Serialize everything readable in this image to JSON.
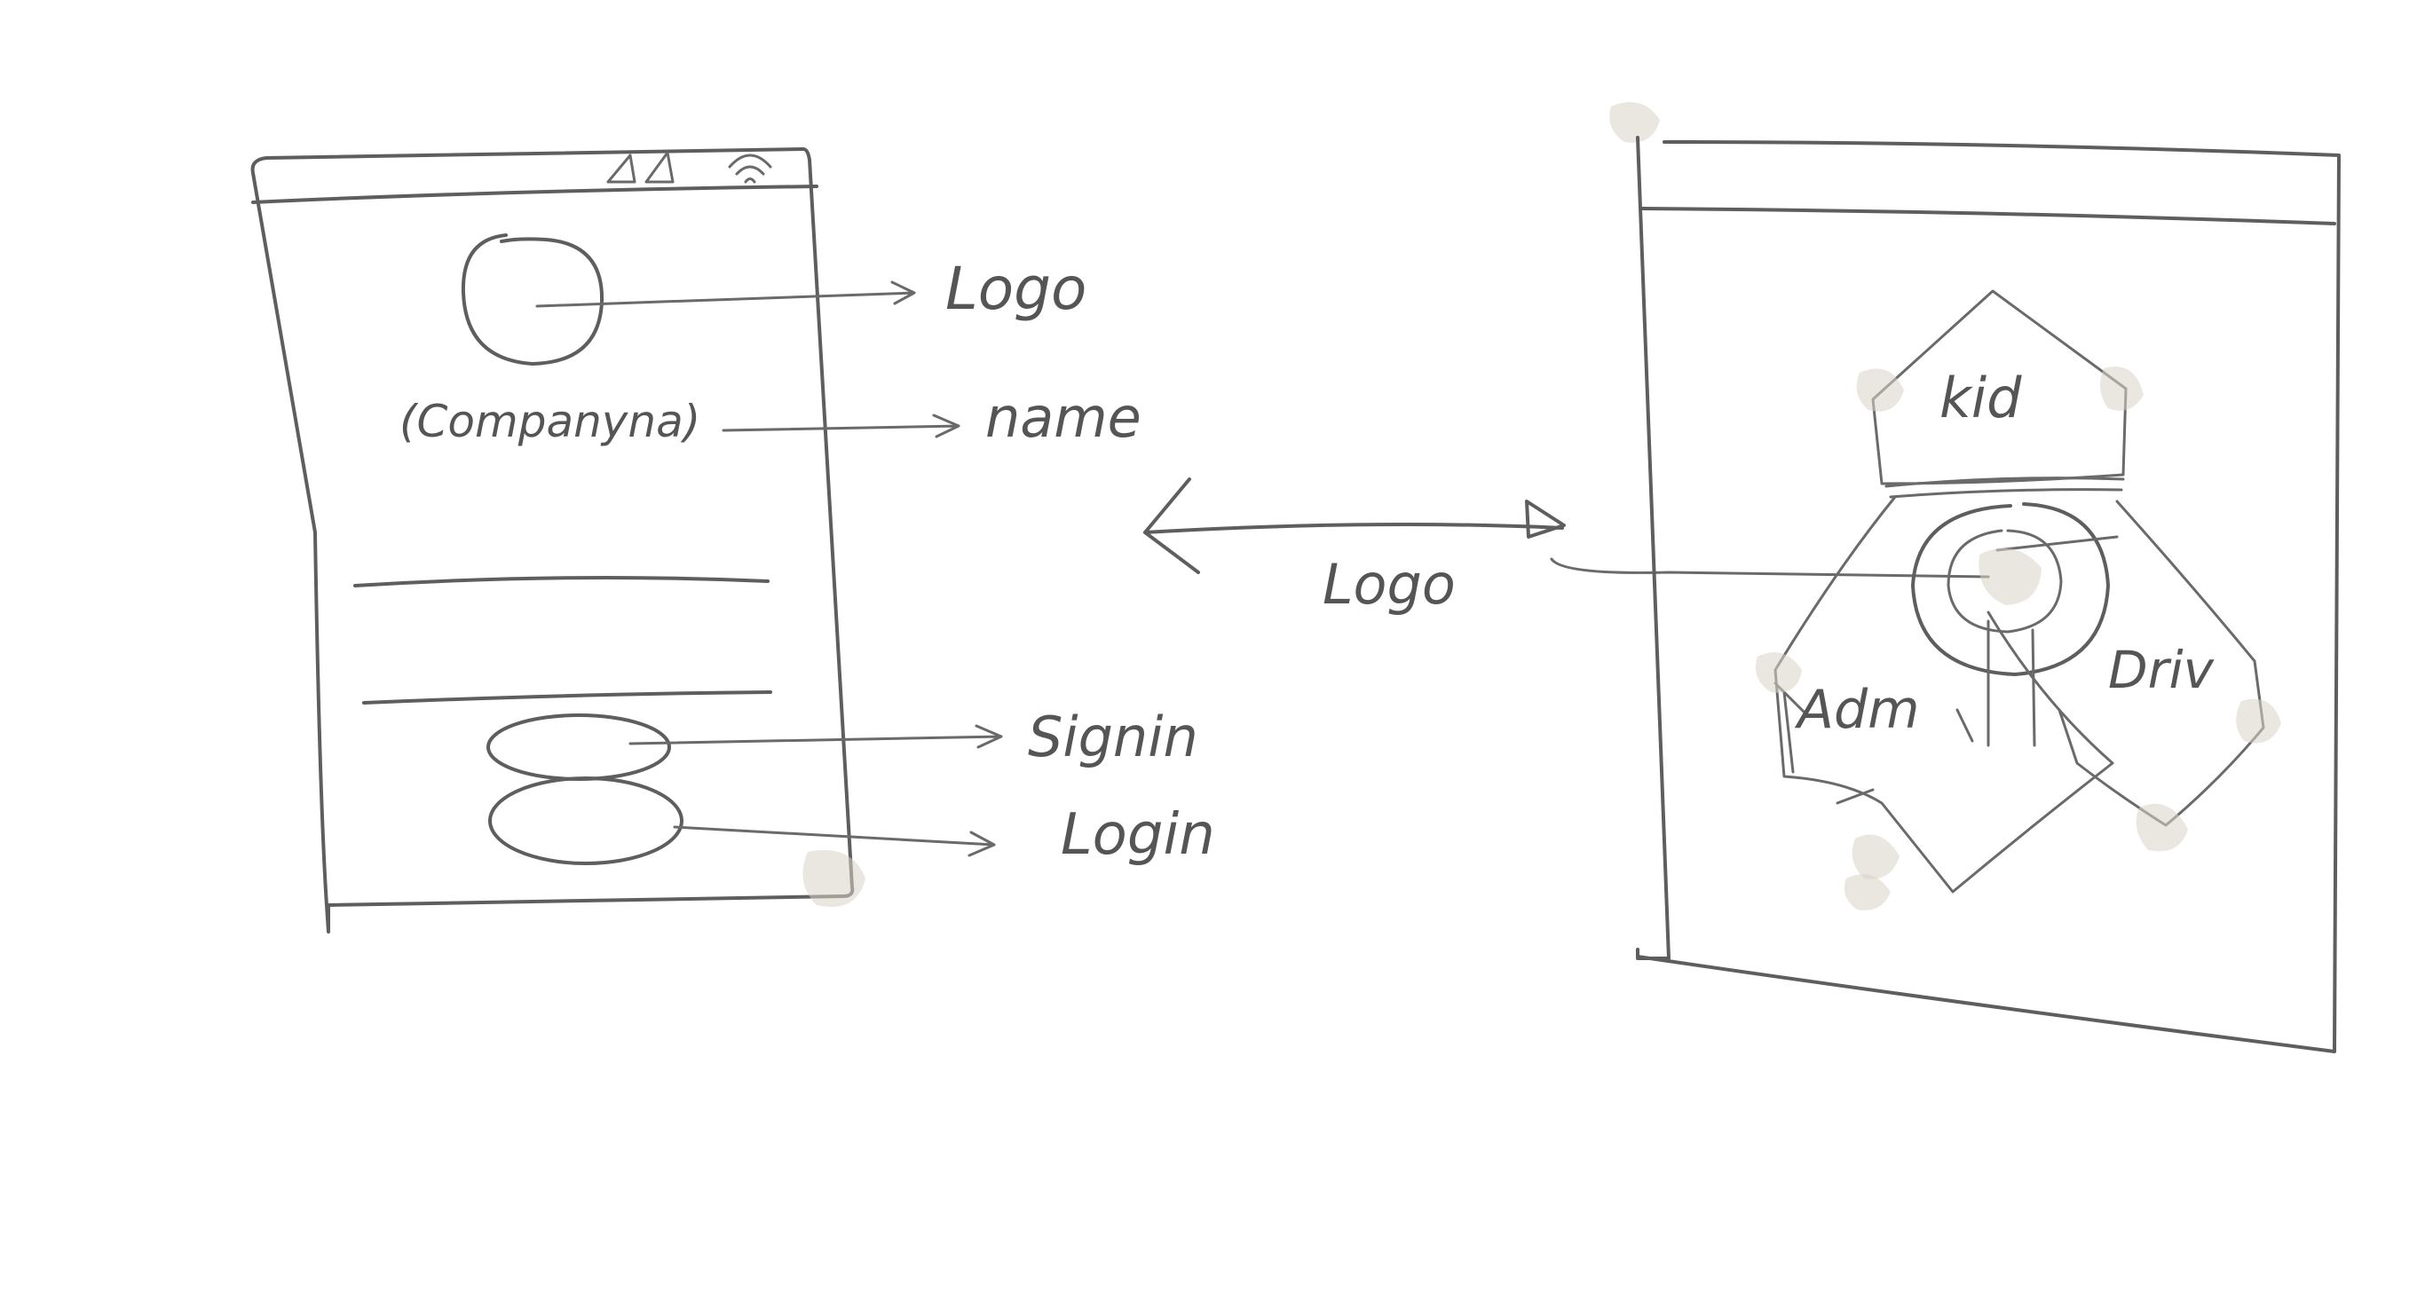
{
  "left_screen": {
    "company_label": "(Companyna)",
    "annotations": {
      "logo": "Logo",
      "name": "name",
      "signin": "Signin",
      "login": "Login"
    }
  },
  "middle": {
    "link_label": "Logo"
  },
  "right_screen": {
    "sections": {
      "kid": "kid",
      "admin": "Adm",
      "driver": "Driv"
    }
  }
}
